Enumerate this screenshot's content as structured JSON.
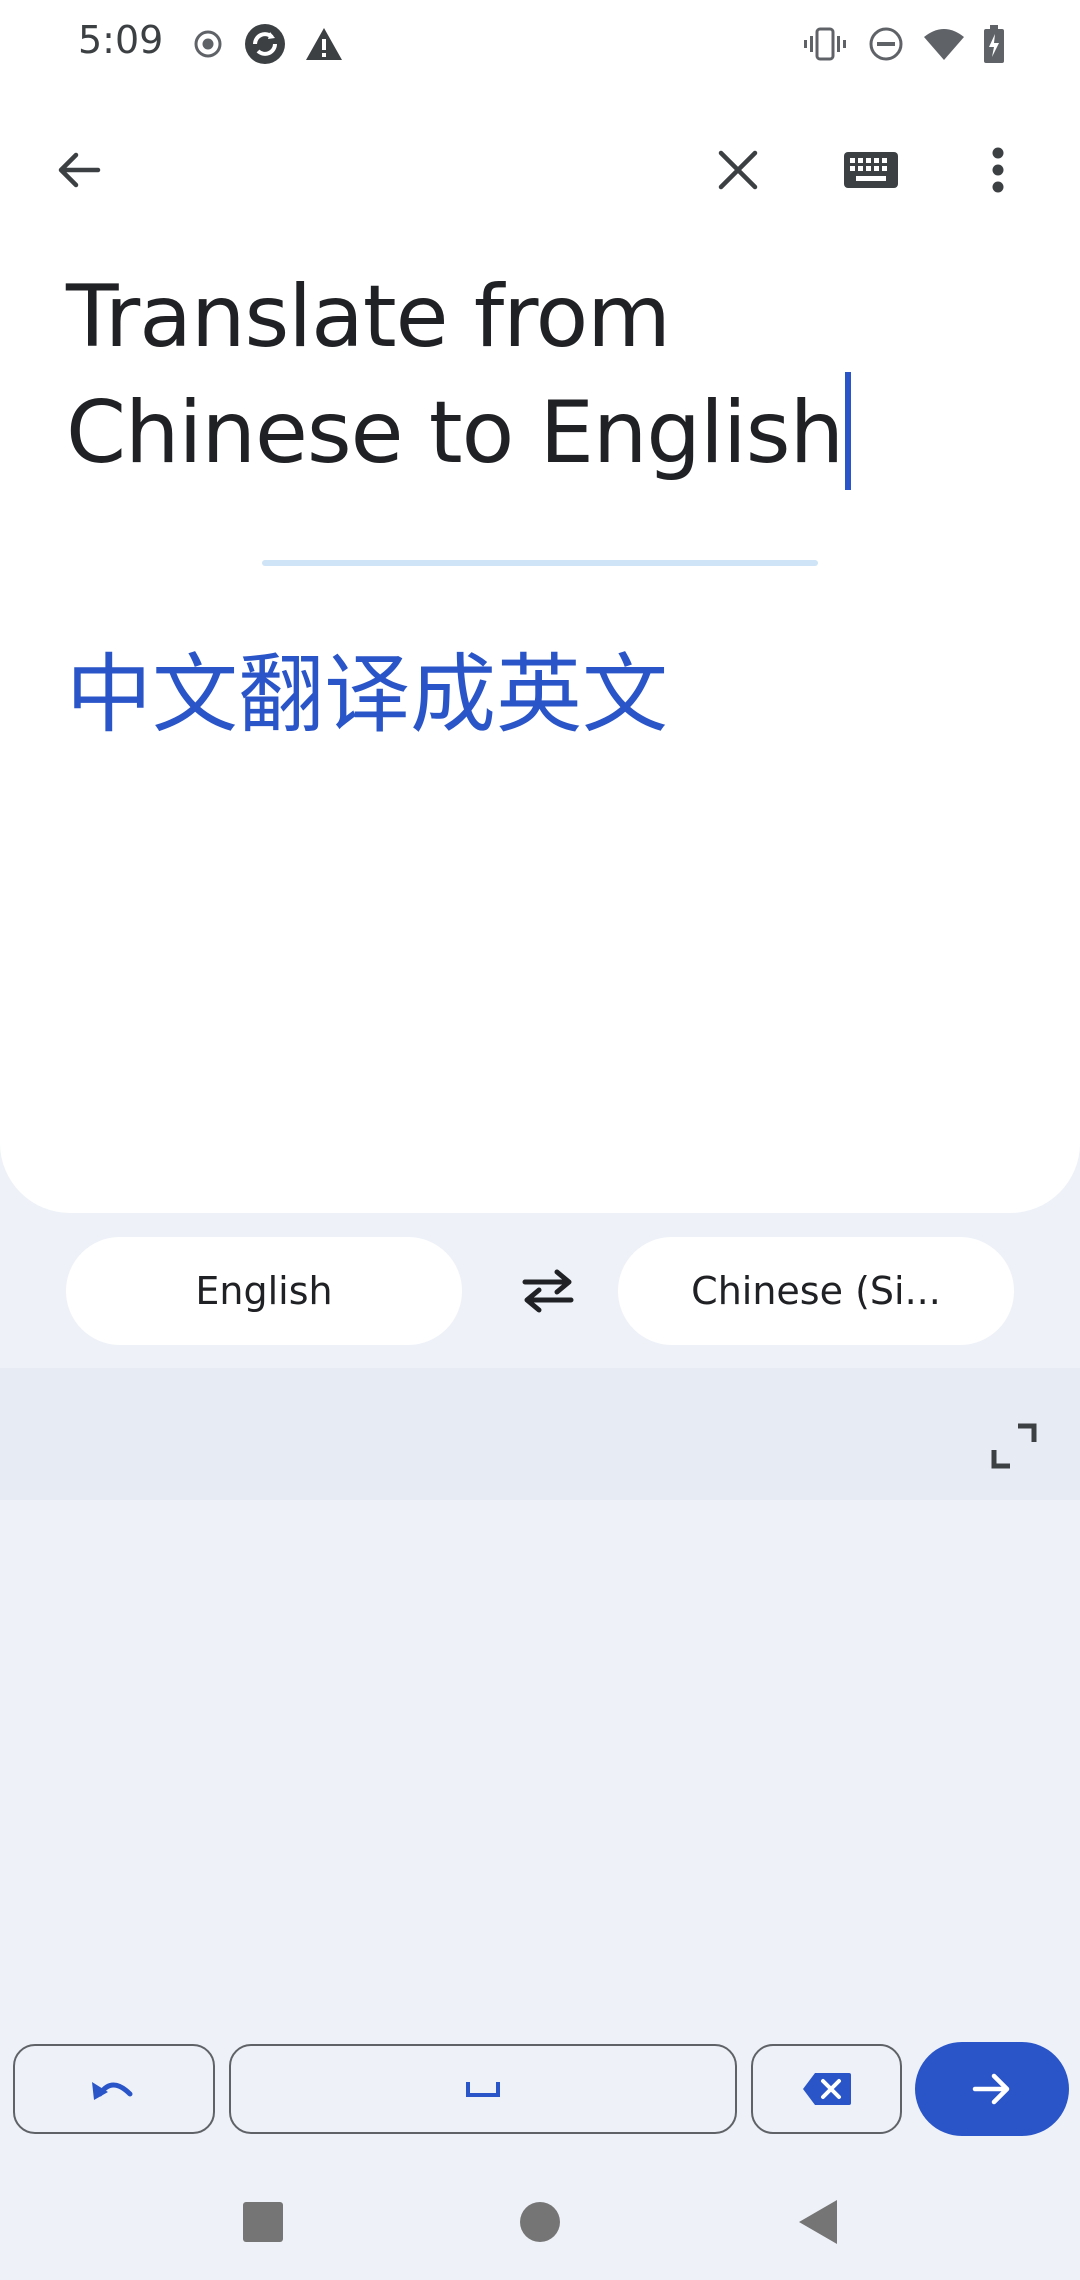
{
  "status_bar": {
    "time": "5:09",
    "left_icons": [
      "record-icon",
      "sync-icon",
      "warning-icon"
    ],
    "right_icons": [
      "vibrate-icon",
      "do-not-disturb-icon",
      "wifi-icon",
      "battery-charging-icon"
    ]
  },
  "toolbar": {
    "back_icon": "arrow-back-icon",
    "clear_icon": "close-icon",
    "keyboard_icon": "keyboard-icon",
    "menu_icon": "more-vert-icon"
  },
  "input": {
    "source_text": "Translate from Chinese to English"
  },
  "output": {
    "translation": "中文翻译成英文"
  },
  "languages": {
    "source": "English",
    "target": "Chinese (Si...",
    "swap_icon": "swap-horiz-icon"
  },
  "handwriting": {
    "expand_icon": "expand-icon"
  },
  "keyboard": {
    "undo_icon": "undo-icon",
    "space_icon": "space-bar-icon",
    "backspace_icon": "backspace-icon",
    "enter_icon": "arrow-forward-icon"
  },
  "nav": {
    "recents_icon": "square-icon",
    "home_icon": "circle-icon",
    "back_icon": "triangle-back-icon"
  },
  "colors": {
    "accent": "#2a55c9",
    "background": "#eef2f8",
    "card": "#ffffff",
    "divider": "#cfe4f6"
  }
}
